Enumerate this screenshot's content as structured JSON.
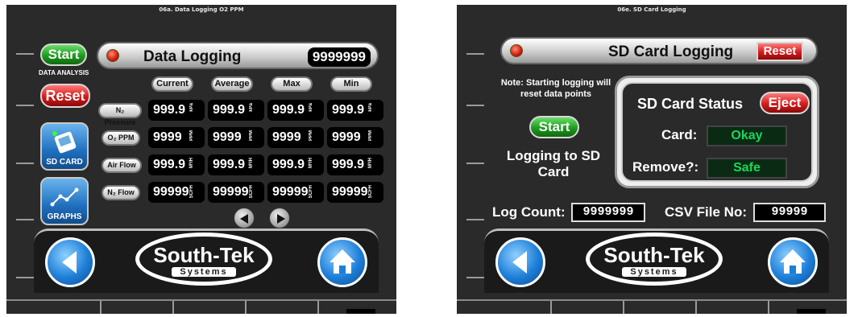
{
  "left": {
    "window_title": "06a. Data Logging O2 PPM",
    "header_title": "Data Logging",
    "header_value": "9999999",
    "start_label": "Start",
    "data_analysis_label": "DATA ANALYSIS",
    "reset_label": "Reset",
    "sd_card_label": "SD CARD",
    "graphs_label": "GRAPHS",
    "columns": [
      "Current",
      "Average",
      "Max",
      "Min"
    ],
    "rows": [
      {
        "label": "N₂ Pressure",
        "value": "999.9",
        "unit": "kPa"
      },
      {
        "label": "O₂ PPM",
        "value": "9999",
        "unit": "PPM"
      },
      {
        "label": "Air Flow",
        "value": "999.9",
        "unit": "M³/H"
      },
      {
        "label": "N₂ Flow",
        "value": "99999",
        "unit": "SCFH"
      }
    ],
    "logo_main": "South-Tek",
    "logo_sub": "Systems"
  },
  "right": {
    "window_title": "06e. SD Card Logging",
    "header_title": "SD Card Logging",
    "reset_label": "Reset",
    "note": "Note: Starting logging will reset data points",
    "start_label": "Start",
    "logging_text": "Logging to SD Card",
    "status_title": "SD Card Status",
    "eject_label": "Eject",
    "card_label": "Card:",
    "card_value": "Okay",
    "remove_label": "Remove?:",
    "remove_value": "Safe",
    "log_count_label": "Log Count:",
    "log_count_value": "9999999",
    "csv_label": "CSV File No:",
    "csv_value": "99999",
    "logo_main": "South-Tek",
    "logo_sub": "Systems"
  }
}
